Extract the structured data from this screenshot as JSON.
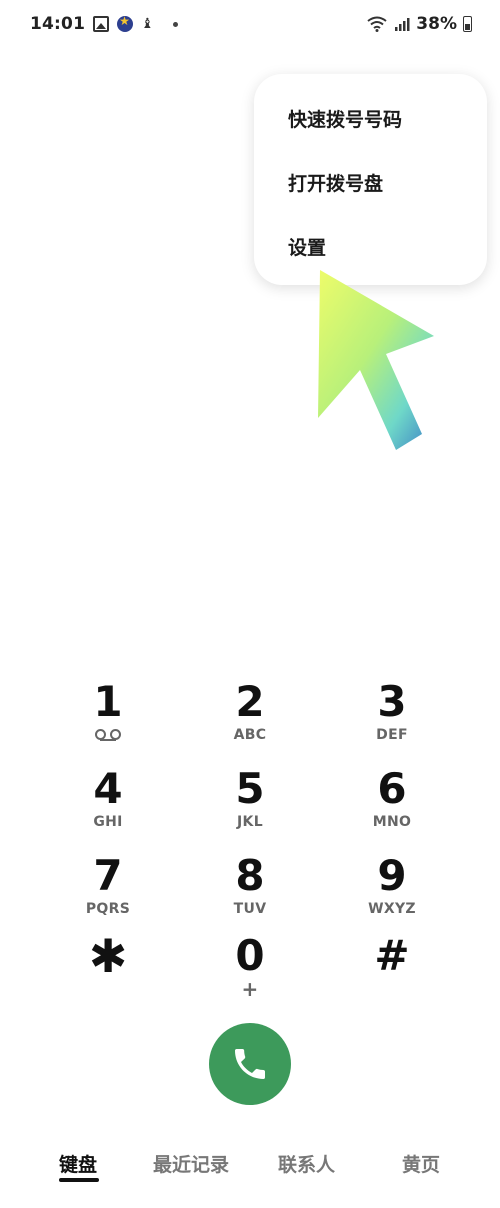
{
  "status_bar": {
    "time": "14:01",
    "battery_percent": "38%",
    "icons": [
      "gallery-icon",
      "app-icon",
      "figure-icon",
      "dot-icon",
      "wifi-icon",
      "signal-icon",
      "battery-icon"
    ]
  },
  "menu": {
    "items": [
      {
        "label": "快速拨号号码"
      },
      {
        "label": "打开拨号盘"
      },
      {
        "label": "设置"
      }
    ]
  },
  "dialpad": {
    "keys": [
      {
        "digit": "1",
        "letters": ""
      },
      {
        "digit": "2",
        "letters": "ABC"
      },
      {
        "digit": "3",
        "letters": "DEF"
      },
      {
        "digit": "4",
        "letters": "GHI"
      },
      {
        "digit": "5",
        "letters": "JKL"
      },
      {
        "digit": "6",
        "letters": "MNO"
      },
      {
        "digit": "7",
        "letters": "PQRS"
      },
      {
        "digit": "8",
        "letters": "TUV"
      },
      {
        "digit": "9",
        "letters": "WXYZ"
      },
      {
        "digit": "✱",
        "letters": ""
      },
      {
        "digit": "0",
        "letters": "+"
      },
      {
        "digit": "#",
        "letters": ""
      }
    ]
  },
  "call_button": {
    "icon": "phone-icon",
    "color": "#3d9a5b"
  },
  "tabs": [
    {
      "label": "键盘",
      "active": true
    },
    {
      "label": "最近记录",
      "active": false
    },
    {
      "label": "联系人",
      "active": false
    },
    {
      "label": "黄页",
      "active": false
    }
  ]
}
